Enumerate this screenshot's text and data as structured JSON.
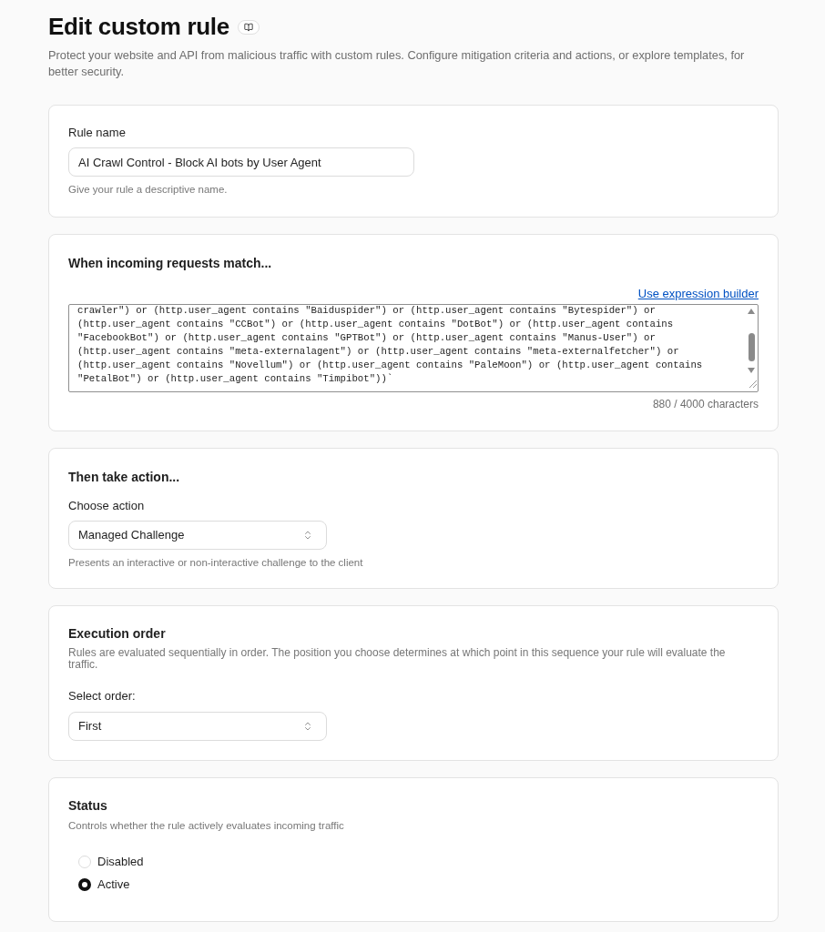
{
  "page": {
    "title": "Edit custom rule",
    "description": "Protect your website and API from malicious traffic with custom rules. Configure mitigation criteria and actions, or explore templates, for better security."
  },
  "rule_name": {
    "label": "Rule name",
    "value": "AI Crawl Control - Block AI bots by User Agent",
    "hint": "Give your rule a descriptive name."
  },
  "match": {
    "heading": "When incoming requests match...",
    "link": "Use expression builder",
    "expression_lines": [
      "crawler\") or (http.user_agent contains \"Baiduspider\") or (http.user_agent contains \"Bytespider\") or",
      "(http.user_agent contains \"CCBot\") or (http.user_agent contains \"DotBot\") or (http.user_agent contains",
      "\"FacebookBot\") or (http.user_agent contains \"GPTBot\") or (http.user_agent contains \"Manus-User\") or",
      "(http.user_agent contains \"meta-externalagent\") or (http.user_agent contains \"meta-externalfetcher\") or",
      "(http.user_agent contains \"Novellum\") or (http.user_agent contains \"PaleMoon\") or (http.user_agent contains",
      "\"PetalBot\") or (http.user_agent contains \"Timpibot\"))`"
    ],
    "counter": "880 / 4000 characters"
  },
  "action": {
    "heading": "Then take action...",
    "label": "Choose action",
    "value": "Managed Challenge",
    "hint": "Presents an interactive or non-interactive challenge to the client"
  },
  "order": {
    "heading": "Execution order",
    "description": "Rules are evaluated sequentially in order. The position you choose determines at which point in this sequence your rule will evaluate the traffic.",
    "label": "Select order:",
    "value": "First"
  },
  "status": {
    "heading": "Status",
    "description": "Controls whether the rule actively evaluates incoming traffic",
    "options": [
      {
        "label": "Disabled",
        "selected": false
      },
      {
        "label": "Active",
        "selected": true
      }
    ]
  }
}
